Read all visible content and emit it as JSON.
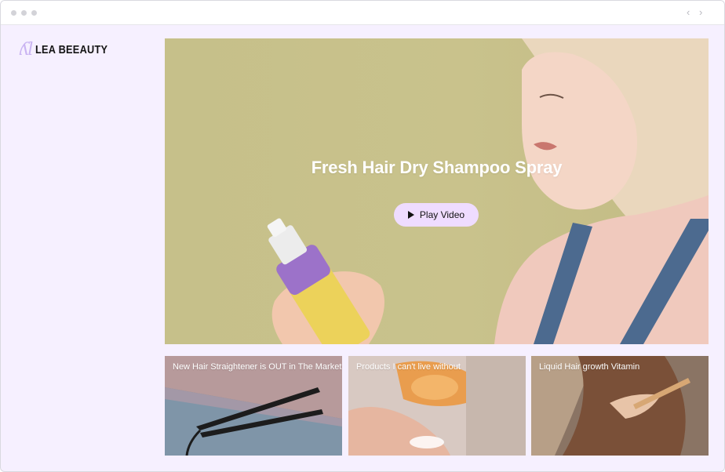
{
  "brand": {
    "logo_mark": "ʎl",
    "name": "LEA BEEAUTY"
  },
  "window": {
    "back_arrow": "‹",
    "forward_arrow": "›"
  },
  "hero": {
    "title": "Fresh Hair Dry Shampoo Spray",
    "play_label": "Play Video"
  },
  "cards": [
    {
      "title": "New Hair Straightener is OUT in The Market"
    },
    {
      "title": "Products I can't live without"
    },
    {
      "title": "Liquid Hair growth Vitamin"
    }
  ],
  "colors": {
    "page_bg": "#f6f0ff",
    "hero_bg": "#c8c18b",
    "play_button": "#efdcff",
    "logo_accent": "#c9b3f2"
  }
}
